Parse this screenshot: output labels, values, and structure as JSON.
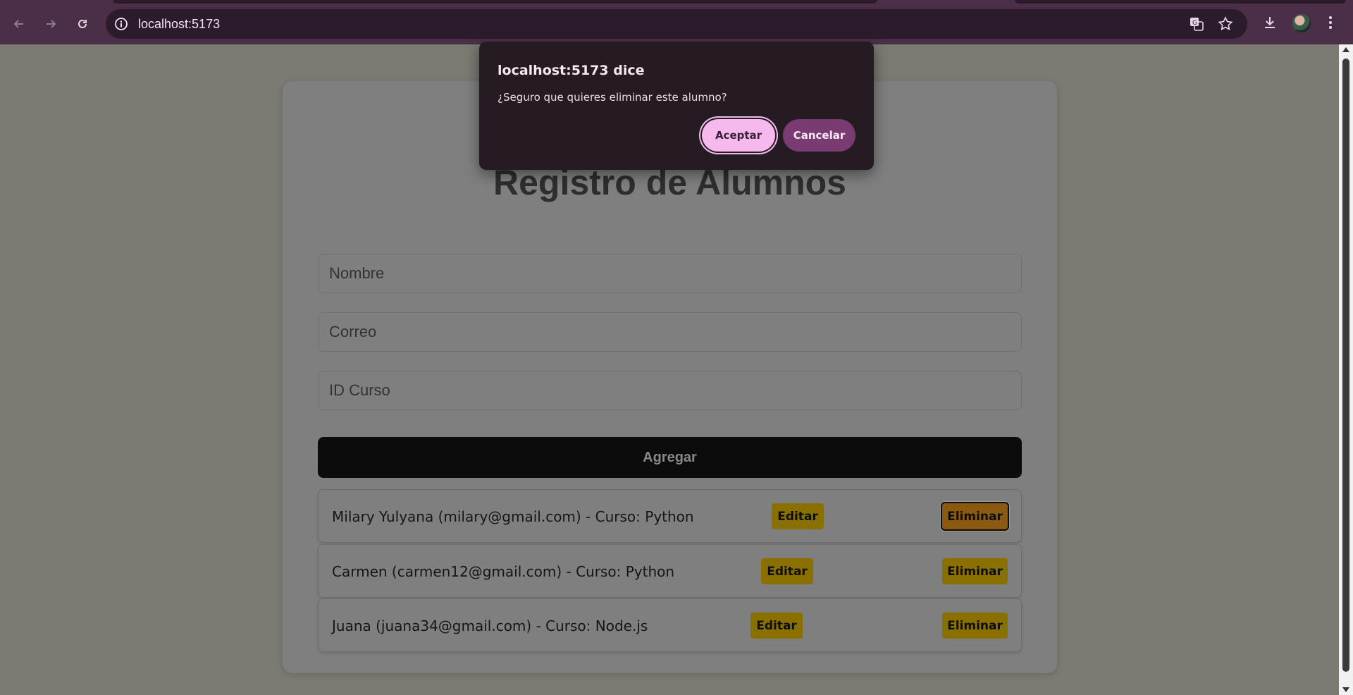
{
  "browser": {
    "url": "localhost:5173",
    "colors": {
      "frame": "#4b2f49",
      "omnibox": "#2c1c2b"
    },
    "icons": [
      "back-arrow-icon",
      "forward-arrow-icon",
      "reload-icon",
      "site-info-icon",
      "translate-icon",
      "bookmark-star-icon",
      "download-icon",
      "profile-avatar-icon",
      "kebab-menu-icon"
    ]
  },
  "page": {
    "title": "Registro de Alumnos",
    "form": {
      "name_placeholder": "Nombre",
      "email_placeholder": "Correo",
      "course_placeholder": "ID Curso",
      "add_label": "Agregar"
    },
    "students": [
      {
        "text": "Milary Yulyana (milary@gmail.com) - Curso: Python",
        "edit_label": "Editar",
        "delete_label": "Eliminar"
      },
      {
        "text": "Carmen (carmen12@gmail.com) - Curso: Python",
        "edit_label": "Editar",
        "delete_label": "Eliminar"
      },
      {
        "text": "Juana (juana34@gmail.com) - Curso: Node.js",
        "edit_label": "Editar",
        "delete_label": "Eliminar"
      }
    ],
    "colors": {
      "action_button": "#f5c400",
      "add_button": "#111111"
    }
  },
  "dialog": {
    "title": "localhost:5173 dice",
    "message": "¿Seguro que quieres eliminar este alumno?",
    "ok_label": "Aceptar",
    "cancel_label": "Cancelar",
    "colors": {
      "background": "#241c22",
      "ok": "#f6b9ee",
      "cancel": "#7a3a72"
    }
  }
}
